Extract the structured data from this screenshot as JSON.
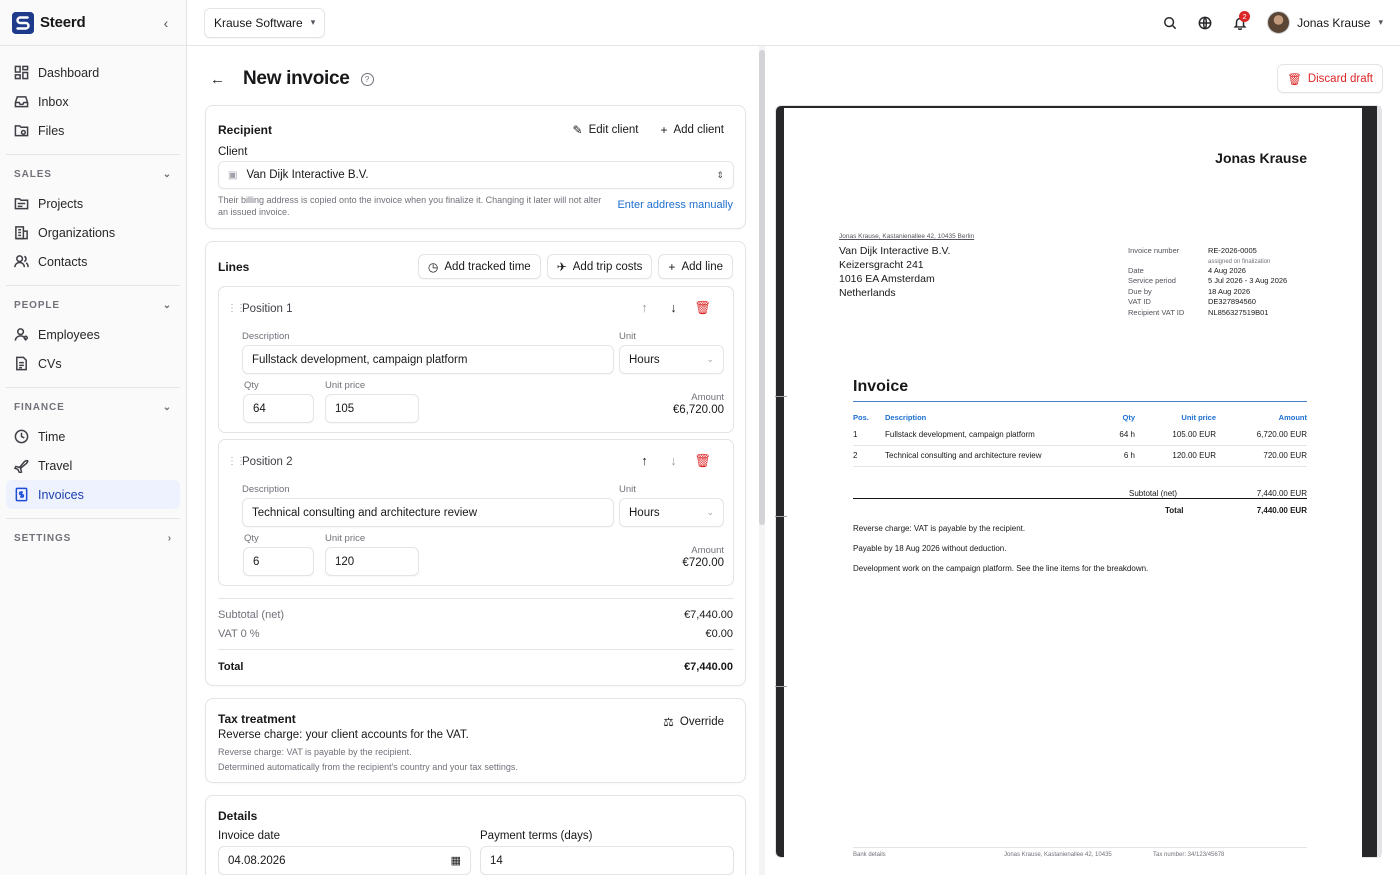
{
  "brand": {
    "name": "Steerd"
  },
  "nav": {
    "items_top": [
      {
        "label": "Dashboard",
        "icon": "dashboard-icon"
      },
      {
        "label": "Inbox",
        "icon": "inbox-icon"
      },
      {
        "label": "Files",
        "icon": "files-icon"
      }
    ],
    "sales": {
      "label": "SALES",
      "items": [
        {
          "label": "Projects",
          "icon": "projects-icon"
        },
        {
          "label": "Organizations",
          "icon": "organizations-icon"
        },
        {
          "label": "Contacts",
          "icon": "contacts-icon"
        }
      ]
    },
    "people": {
      "label": "PEOPLE",
      "items": [
        {
          "label": "Employees",
          "icon": "employees-icon"
        },
        {
          "label": "CVs",
          "icon": "cvs-icon"
        }
      ]
    },
    "finance": {
      "label": "FINANCE",
      "items": [
        {
          "label": "Time",
          "icon": "time-icon"
        },
        {
          "label": "Travel",
          "icon": "travel-icon"
        },
        {
          "label": "Invoices",
          "icon": "invoices-icon",
          "active": true
        }
      ]
    },
    "settings": {
      "label": "SETTINGS"
    }
  },
  "topbar": {
    "org": "Krause Software",
    "notifications": "2",
    "user": "Jonas Krause"
  },
  "page": {
    "title": "New invoice"
  },
  "recipient": {
    "title": "Recipient",
    "edit_client": "Edit client",
    "add_client": "Add client",
    "client_label": "Client",
    "client_value": "Van Dijk Interactive B.V.",
    "hint": "Their billing address is copied onto the invoice when you finalize it. Changing it later will not alter an issued invoice.",
    "enter_manual": "Enter address manually"
  },
  "lines": {
    "title": "Lines",
    "add_tracked": "Add tracked time",
    "add_trip": "Add trip costs",
    "add_line": "Add line",
    "desc_label": "Description",
    "unit_label": "Unit",
    "qty_label": "Qty",
    "price_label": "Unit price",
    "amount_label": "Amount",
    "positions": [
      {
        "title": "Position 1",
        "description": "Fullstack development, campaign platform",
        "unit": "Hours",
        "qty": "64",
        "price": "105",
        "amount": "€6,720.00"
      },
      {
        "title": "Position 2",
        "description": "Technical consulting and architecture review",
        "unit": "Hours",
        "qty": "6",
        "price": "120",
        "amount": "€720.00"
      }
    ],
    "subtotal_label": "Subtotal (net)",
    "subtotal": "€7,440.00",
    "vat_label": "VAT 0 %",
    "vat": "€0.00",
    "total_label": "Total",
    "total": "€7,440.00"
  },
  "tax": {
    "title": "Tax treatment",
    "override": "Override",
    "headline": "Reverse charge: your client accounts for the VAT.",
    "line1": "Reverse charge: VAT is payable by the recipient.",
    "line2": "Determined automatically from the recipient's country and your tax settings."
  },
  "details": {
    "title": "Details",
    "date_label": "Invoice date",
    "date": "04.08.2026",
    "terms_label": "Payment terms (days)",
    "terms": "14"
  },
  "preview": {
    "discard": "Discard draft",
    "sender": "Jonas Krause",
    "return_line": "Jonas Krause, Kastanienallee 42, 10435 Berlin",
    "address": [
      "Van Dijk Interactive B.V.",
      "Keizersgracht 241",
      "1016 EA Amsterdam",
      "Netherlands"
    ],
    "meta": [
      {
        "k": "Invoice number",
        "v": "RE-2026-0005"
      },
      {
        "k": "",
        "v": "assigned on finalization"
      },
      {
        "k": "Date",
        "v": "4 Aug 2026"
      },
      {
        "k": "Service period",
        "v": "5 Jul 2026 - 3 Aug 2026"
      },
      {
        "k": "Due by",
        "v": "18 Aug 2026"
      },
      {
        "k": "VAT ID",
        "v": "DE327894560"
      },
      {
        "k": "Recipient VAT ID",
        "v": "NL856327519B01"
      }
    ],
    "doc_title": "Invoice",
    "headers": {
      "pos": "Pos.",
      "desc": "Description",
      "qty": "Qty",
      "price": "Unit price",
      "amount": "Amount"
    },
    "rows": [
      {
        "pos": "1",
        "desc": "Fullstack development, campaign platform",
        "qty": "64 h",
        "price": "105.00 EUR",
        "amount": "6,720.00 EUR"
      },
      {
        "pos": "2",
        "desc": "Technical consulting and architecture review",
        "qty": "6 h",
        "price": "120.00 EUR",
        "amount": "720.00 EUR"
      }
    ],
    "subtotal_label": "Subtotal (net)",
    "subtotal": "7,440.00 EUR",
    "total_label": "Total",
    "total": "7,440.00 EUR",
    "notes": [
      "Reverse charge: VAT is payable by the recipient.",
      "Payable by 18 Aug 2026 without deduction.",
      "Development work on the campaign platform. See the line items for the breakdown."
    ],
    "footer": [
      "Bank details",
      "Jonas Krause, Kastanienallee 42, 10435",
      "Tax number: 34/123/45678"
    ]
  }
}
